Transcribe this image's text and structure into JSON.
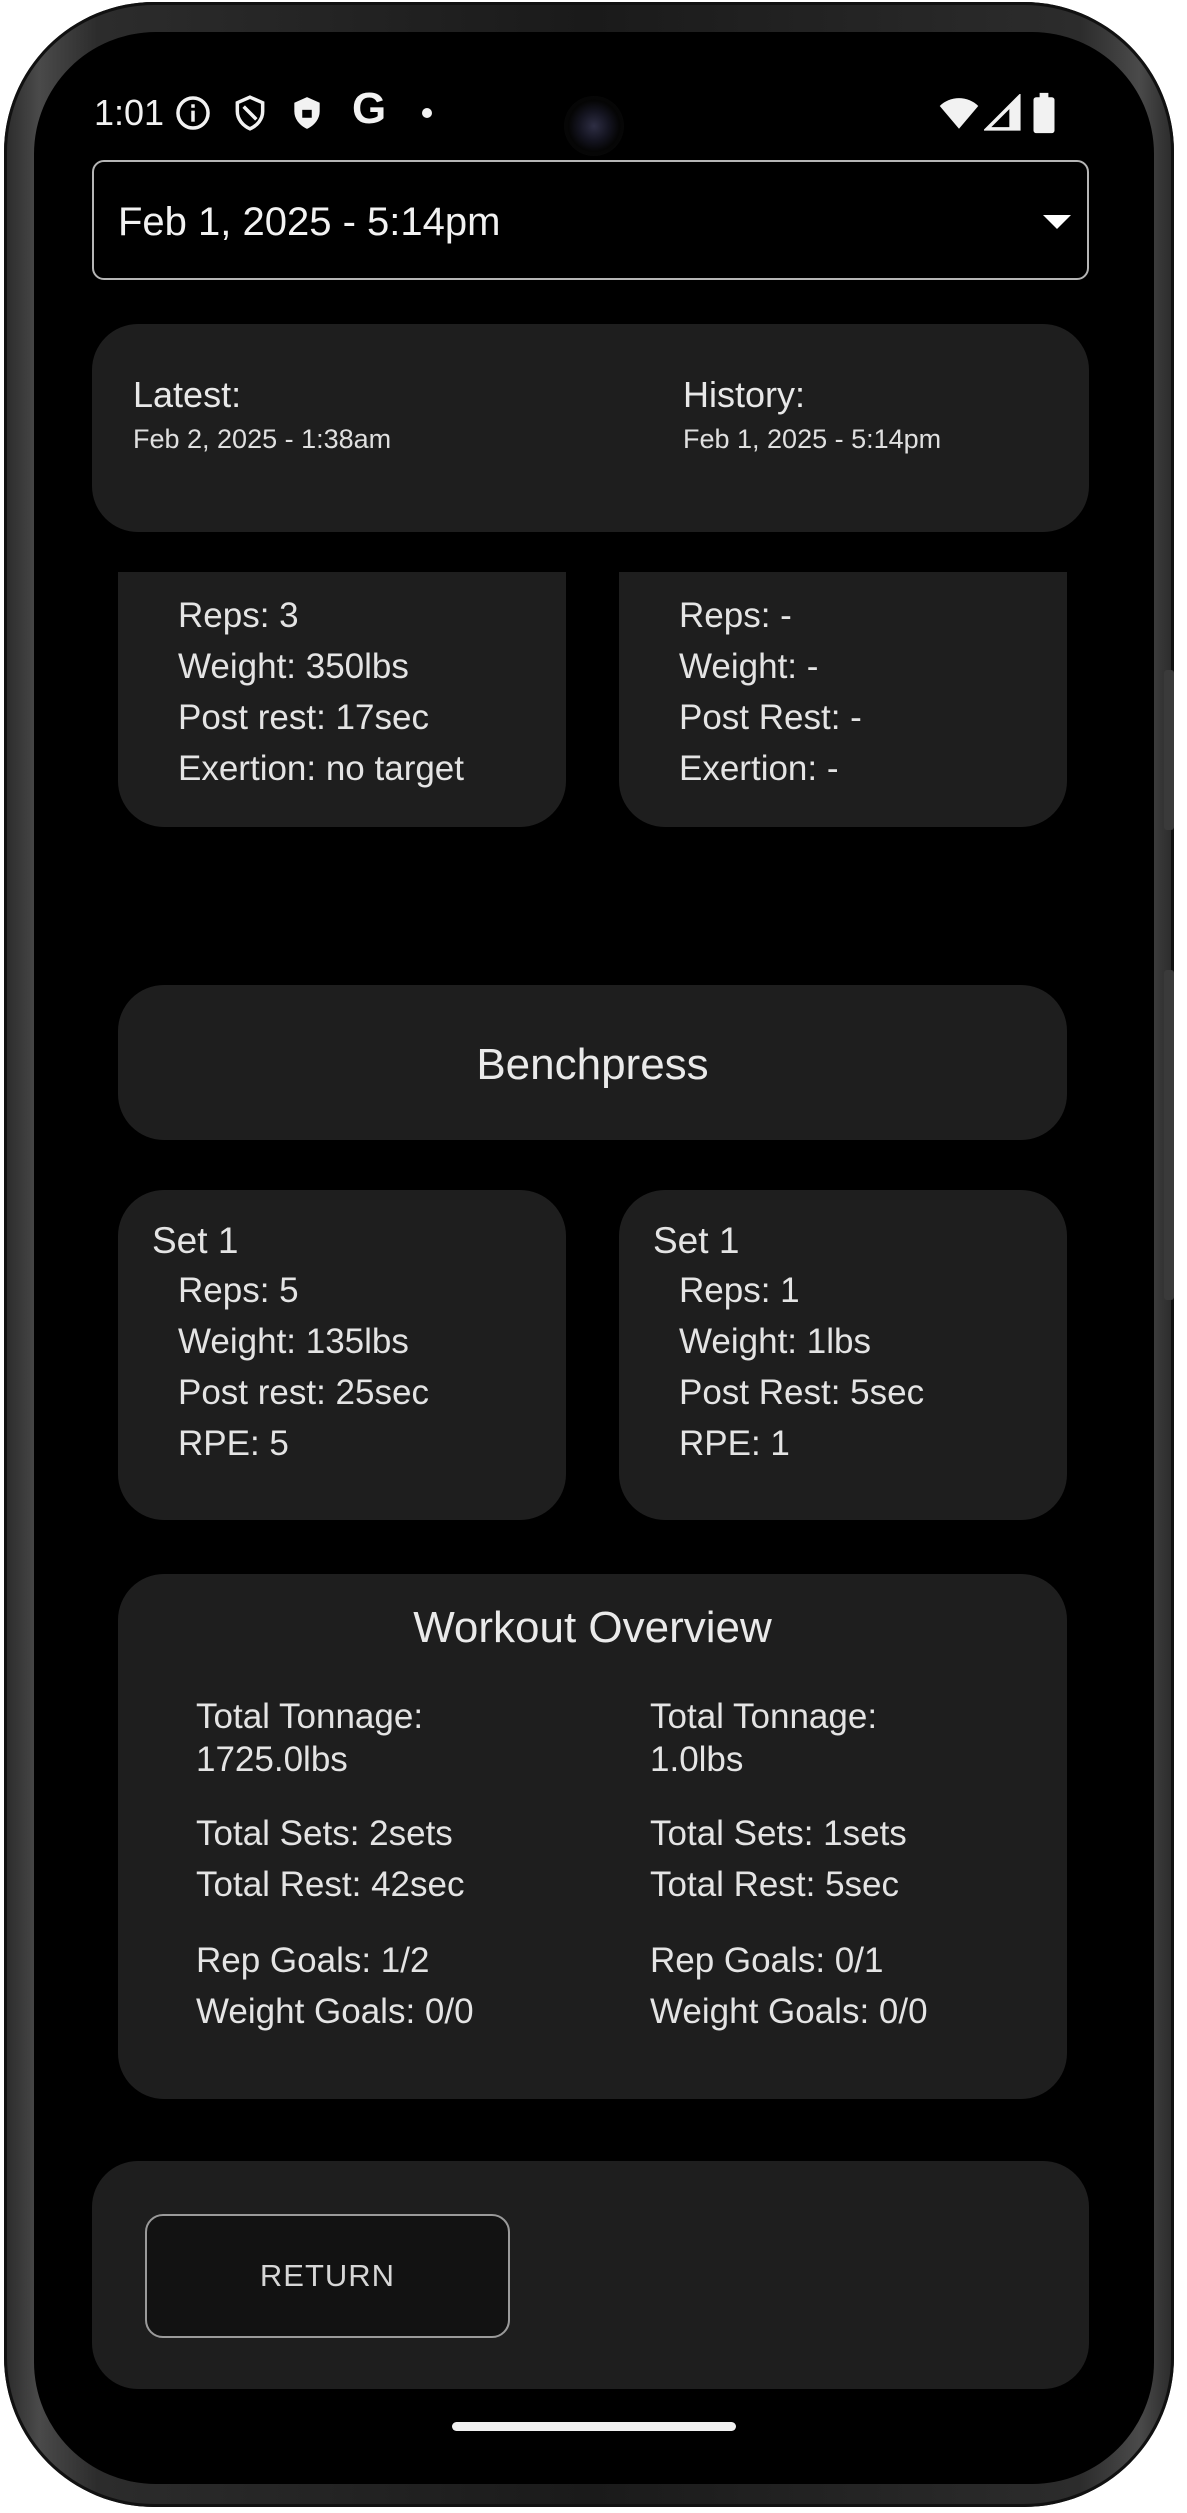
{
  "status_bar": {
    "time": "1:01",
    "left_icons": [
      "info-icon",
      "shield-outline-icon",
      "shield-filled-icon",
      "google-icon",
      "dot-icon"
    ],
    "right_icons": [
      "wifi-icon",
      "signal-icon",
      "battery-icon"
    ]
  },
  "date_selector": {
    "selected": "Feb 1, 2025 - 5:14pm"
  },
  "compare_header": {
    "left": {
      "label": "Latest:",
      "date": "Feb 2, 2025 - 1:38am"
    },
    "right": {
      "label": "History:",
      "date": "Feb 1, 2025 - 5:14pm"
    }
  },
  "partial_sets": {
    "left": [
      "Reps: 3",
      "Weight: 350lbs",
      "Post rest: 17sec",
      "Exertion: no target"
    ],
    "right": [
      "Reps: -",
      "Weight: -",
      "Post Rest: -",
      "Exertion: -"
    ]
  },
  "exercise": {
    "name": "Benchpress"
  },
  "sets": {
    "left": {
      "title": "Set 1",
      "lines": [
        "Reps: 5",
        "Weight: 135lbs",
        "Post rest: 25sec",
        "RPE: 5"
      ]
    },
    "right": {
      "title": "Set 1",
      "lines": [
        "Reps: 1",
        "Weight: 1lbs",
        "Post Rest: 5sec",
        "RPE: 1"
      ]
    }
  },
  "overview": {
    "title": "Workout Overview",
    "left": {
      "tonnage_label": "Total Tonnage:",
      "tonnage_value": "1725.0lbs",
      "sets": "Total Sets: 2sets",
      "rest": "Total Rest: 42sec",
      "rep_goals": "Rep Goals: 1/2",
      "weight_goals": "Weight Goals: 0/0"
    },
    "right": {
      "tonnage_label": "Total Tonnage:",
      "tonnage_value": "1.0lbs",
      "sets": "Total Sets: 1sets",
      "rest": "Total Rest: 5sec",
      "rep_goals": "Rep Goals: 0/1",
      "weight_goals": "Weight Goals: 0/0"
    }
  },
  "footer": {
    "return_label": "RETURN"
  },
  "colors": {
    "background": "#000000",
    "card": "#1e1e1e",
    "text": "#e6e6e6"
  }
}
